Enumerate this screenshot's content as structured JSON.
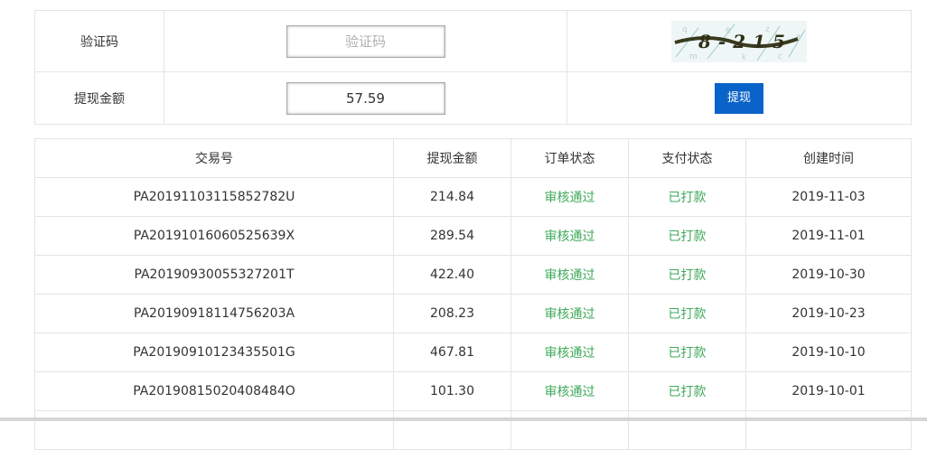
{
  "form": {
    "captcha_label": "验证码",
    "captcha_placeholder": "验证码",
    "captcha_image_text": "8-215",
    "amount_label": "提现金额",
    "amount_value": "57.59",
    "submit_label": "提现"
  },
  "table": {
    "headers": [
      "交易号",
      "提现金额",
      "订单状态",
      "支付状态",
      "创建时间"
    ],
    "rows": [
      {
        "id": "PA20191103115852782U",
        "amount": "214.84",
        "order_status": "审核通过",
        "pay_status": "已打款",
        "date": "2019-11-03"
      },
      {
        "id": "PA20191016060525639X",
        "amount": "289.54",
        "order_status": "审核通过",
        "pay_status": "已打款",
        "date": "2019-11-01"
      },
      {
        "id": "PA20190930055327201T",
        "amount": "422.40",
        "order_status": "审核通过",
        "pay_status": "已打款",
        "date": "2019-10-30"
      },
      {
        "id": "PA20190918114756203A",
        "amount": "208.23",
        "order_status": "审核通过",
        "pay_status": "已打款",
        "date": "2019-10-23"
      },
      {
        "id": "PA20190910123435501G",
        "amount": "467.81",
        "order_status": "审核通过",
        "pay_status": "已打款",
        "date": "2019-10-10"
      },
      {
        "id": "PA20190815020408484O",
        "amount": "101.30",
        "order_status": "审核通过",
        "pay_status": "已打款",
        "date": "2019-10-01"
      }
    ]
  },
  "colors": {
    "accent": "#0a63c9",
    "status_green": "#3fa95a",
    "border": "#e4e4e4"
  }
}
